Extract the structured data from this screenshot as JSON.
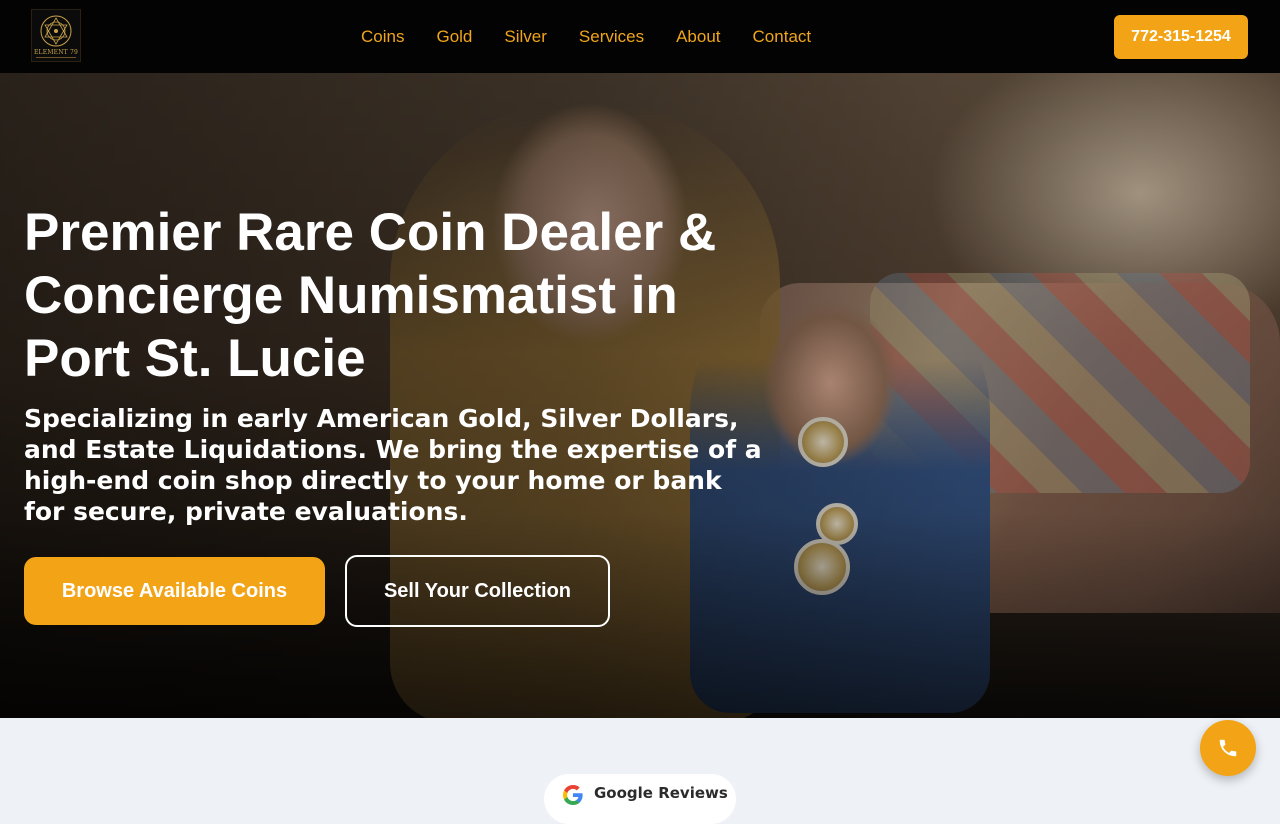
{
  "brand": {
    "logo_text": "ELEMENT 79",
    "logo_icon": "gold-emblem-icon"
  },
  "nav": {
    "items": [
      {
        "label": "Coins"
      },
      {
        "label": "Gold"
      },
      {
        "label": "Silver"
      },
      {
        "label": "Services"
      },
      {
        "label": "About"
      },
      {
        "label": "Contact"
      }
    ]
  },
  "header": {
    "phone_label": "772-315-1254"
  },
  "hero": {
    "title": "Premier Rare Coin Dealer & Concierge Numismatist in Port St. Lucie",
    "subtitle": "Specializing in early American Gold, Silver Dollars, and Estate Liquidations. We bring the expertise of a high-end coin shop directly to your home or bank for secure, private evaluations.",
    "primary_button": "Browse Available Coins",
    "secondary_button": "Sell Your Collection"
  },
  "reviews": {
    "label": "Google Reviews",
    "icon": "google-icon"
  },
  "fab": {
    "icon": "phone-icon"
  },
  "colors": {
    "accent": "#f3a416",
    "nav_text": "#f0a51b",
    "topbar": "#030303",
    "page_bg": "#eef1f5"
  }
}
